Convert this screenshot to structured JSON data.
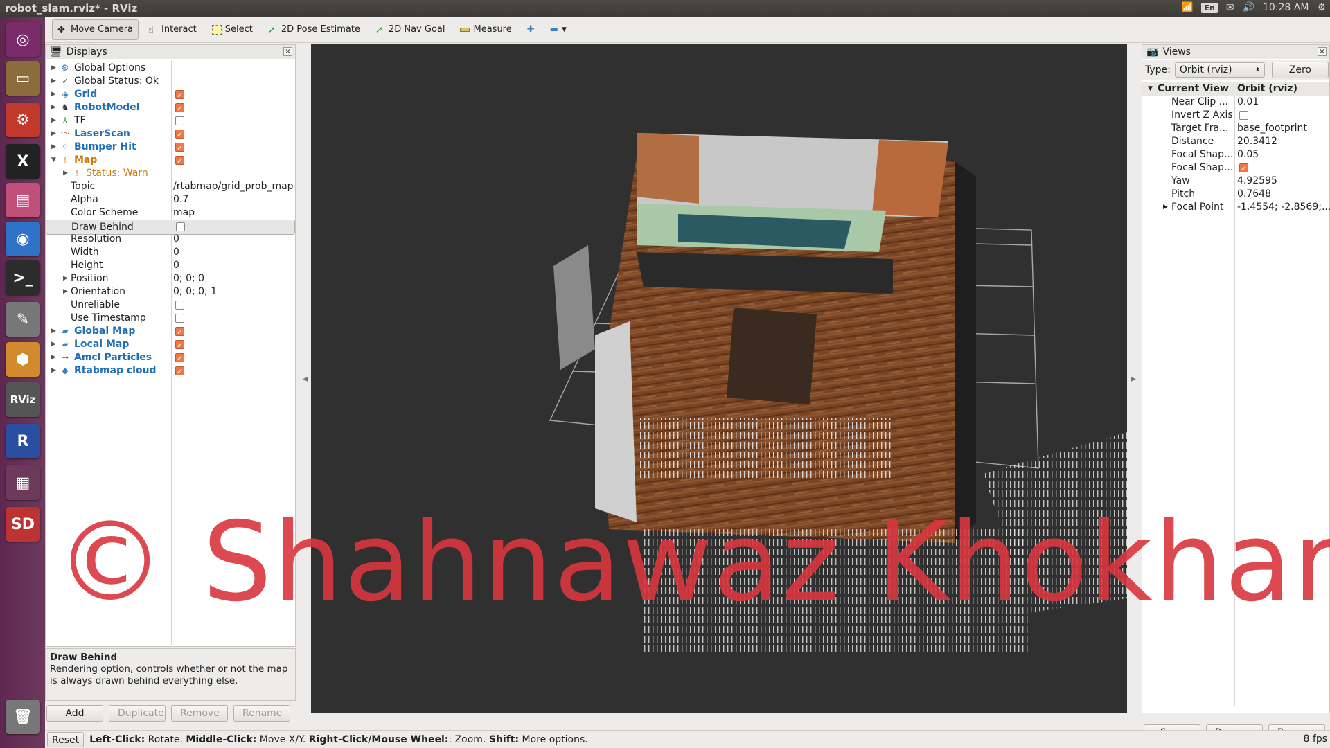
{
  "window_title": "robot_slam.rviz* - RViz",
  "tray": {
    "lang": "En",
    "time": "10:28 AM"
  },
  "launcher": [
    {
      "name": "ubuntu-dash-icon",
      "label": "◎",
      "color": "#7a2b6a"
    },
    {
      "name": "files-icon",
      "label": "▭",
      "color": "#8a6d3b"
    },
    {
      "name": "system-settings-icon",
      "label": "⚙",
      "color": "#c0392b"
    },
    {
      "name": "xterm-icon",
      "label": "X",
      "color": "#222"
    },
    {
      "name": "window-icon",
      "label": "▤",
      "color": "#c0507a"
    },
    {
      "name": "chromium-icon",
      "label": "◉",
      "color": "#2f73c9"
    },
    {
      "name": "terminal-icon",
      "label": ">_",
      "color": "#2c2c2c"
    },
    {
      "name": "text-editor-icon",
      "label": "✎",
      "color": "#777"
    },
    {
      "name": "package-icon",
      "label": "⬢",
      "color": "#d28a2e"
    },
    {
      "name": "rviz-icon",
      "label": "RViz",
      "color": "#555"
    },
    {
      "name": "rqt-icon",
      "label": "R",
      "color": "#2a4fa0"
    },
    {
      "name": "workspace-icon",
      "label": "▦",
      "color": "#6d3a5c"
    },
    {
      "name": "sd-card-icon",
      "label": "SD",
      "color": "#b33"
    },
    {
      "name": "trash-icon",
      "label": "🗑",
      "color": "#777"
    }
  ],
  "toolbar": {
    "tools": [
      "Move Camera",
      "Interact",
      "Select",
      "2D Pose Estimate",
      "2D Nav Goal",
      "Measure"
    ]
  },
  "displays": {
    "title": "Displays",
    "rows": [
      {
        "name": "Global Options",
        "style": "",
        "value": "",
        "cb": null,
        "indent": 0,
        "arrow": "▶",
        "icon": "⚙",
        "iconColor": "#3a7fc1"
      },
      {
        "name": "Global Status: Ok",
        "style": "",
        "value": "",
        "cb": null,
        "indent": 0,
        "arrow": "▶",
        "icon": "✓",
        "iconColor": "#1a7a1a"
      },
      {
        "name": "Grid",
        "style": "blue",
        "value": "",
        "cb": true,
        "indent": 0,
        "arrow": "▶",
        "icon": "◈",
        "iconColor": "#3a7fc1"
      },
      {
        "name": "RobotModel",
        "style": "blue",
        "value": "",
        "cb": true,
        "indent": 0,
        "arrow": "▶",
        "icon": "♞",
        "iconColor": "#333"
      },
      {
        "name": "TF",
        "style": "",
        "value": "",
        "cb": false,
        "indent": 0,
        "arrow": "▶",
        "icon": "⅄",
        "iconColor": "#2a8a2a"
      },
      {
        "name": "LaserScan",
        "style": "blue",
        "value": "",
        "cb": true,
        "indent": 0,
        "arrow": "▶",
        "icon": "〰",
        "iconColor": "#c33"
      },
      {
        "name": "Bumper Hit",
        "style": "blue",
        "value": "",
        "cb": true,
        "indent": 0,
        "arrow": "▶",
        "icon": "⁘",
        "iconColor": "#3a7fc1"
      },
      {
        "name": "Map",
        "style": "orange",
        "value": "",
        "cb": true,
        "indent": 0,
        "arrow": "▼",
        "icon": "!",
        "iconColor": "#e08a1a"
      },
      {
        "name": "Status: Warn",
        "style": "orangeplain",
        "value": "",
        "cb": null,
        "indent": 1,
        "arrow": "▶",
        "icon": "!",
        "iconColor": "#e08a1a"
      },
      {
        "name": "Topic",
        "style": "",
        "value": "/rtabmap/grid_prob_map",
        "cb": null,
        "indent": 1,
        "arrow": "",
        "icon": "",
        "iconColor": ""
      },
      {
        "name": "Alpha",
        "style": "",
        "value": "0.7",
        "cb": null,
        "indent": 1,
        "arrow": "",
        "icon": "",
        "iconColor": ""
      },
      {
        "name": "Color Scheme",
        "style": "",
        "value": "map",
        "cb": null,
        "indent": 1,
        "arrow": "",
        "icon": "",
        "iconColor": ""
      },
      {
        "name": "Draw Behind",
        "style": "",
        "value": "",
        "cb": false,
        "indent": 1,
        "arrow": "",
        "icon": "",
        "iconColor": "",
        "selected": true
      },
      {
        "name": "Resolution",
        "style": "",
        "value": "0",
        "cb": null,
        "indent": 1,
        "arrow": "",
        "icon": "",
        "iconColor": ""
      },
      {
        "name": "Width",
        "style": "",
        "value": "0",
        "cb": null,
        "indent": 1,
        "arrow": "",
        "icon": "",
        "iconColor": ""
      },
      {
        "name": "Height",
        "style": "",
        "value": "0",
        "cb": null,
        "indent": 1,
        "arrow": "",
        "icon": "",
        "iconColor": ""
      },
      {
        "name": "Position",
        "style": "",
        "value": "0; 0; 0",
        "cb": null,
        "indent": 1,
        "arrow": "▶",
        "icon": "",
        "iconColor": ""
      },
      {
        "name": "Orientation",
        "style": "",
        "value": "0; 0; 0; 1",
        "cb": null,
        "indent": 1,
        "arrow": "▶",
        "icon": "",
        "iconColor": ""
      },
      {
        "name": "Unreliable",
        "style": "",
        "value": "",
        "cb": false,
        "indent": 1,
        "arrow": "",
        "icon": "",
        "iconColor": ""
      },
      {
        "name": "Use Timestamp",
        "style": "",
        "value": "",
        "cb": false,
        "indent": 1,
        "arrow": "",
        "icon": "",
        "iconColor": ""
      },
      {
        "name": "Global Map",
        "style": "blue",
        "value": "",
        "cb": true,
        "indent": 0,
        "arrow": "▶",
        "icon": "▰",
        "iconColor": "#3a7fc1"
      },
      {
        "name": "Local Map",
        "style": "blue",
        "value": "",
        "cb": true,
        "indent": 0,
        "arrow": "▶",
        "icon": "▰",
        "iconColor": "#3a7fc1"
      },
      {
        "name": "Amcl Particles",
        "style": "blue",
        "value": "",
        "cb": true,
        "indent": 0,
        "arrow": "▶",
        "icon": "⇝",
        "iconColor": "#c33"
      },
      {
        "name": "Rtabmap cloud",
        "style": "blue",
        "value": "",
        "cb": true,
        "indent": 0,
        "arrow": "▶",
        "icon": "◆",
        "iconColor": "#3a7fc1"
      }
    ],
    "help_title": "Draw Behind",
    "help_text": "Rendering option, controls whether or not the map is always drawn behind everything else.",
    "buttons": [
      "Add",
      "Duplicate",
      "Remove",
      "Rename"
    ]
  },
  "views": {
    "title": "Views",
    "type_label": "Type:",
    "type_value": "Orbit (rviz)",
    "zero_label": "Zero",
    "rows": [
      {
        "name": "Current View",
        "value": "Orbit (rviz)",
        "header": true,
        "arrow": "▼"
      },
      {
        "name": "Near Clip ...",
        "value": "0.01"
      },
      {
        "name": "Invert Z Axis",
        "value": "",
        "cb": false
      },
      {
        "name": "Target Fra...",
        "value": "base_footprint"
      },
      {
        "name": "Distance",
        "value": "20.3412"
      },
      {
        "name": "Focal Shap...",
        "value": "0.05"
      },
      {
        "name": "Focal Shap...",
        "value": "",
        "cb": true
      },
      {
        "name": "Yaw",
        "value": "4.92595"
      },
      {
        "name": "Pitch",
        "value": "0.7648"
      },
      {
        "name": "Focal Point",
        "value": "-1.4554; -2.8569;...",
        "arrow": "▶"
      }
    ],
    "buttons": [
      "Save",
      "Remove",
      "Rename"
    ]
  },
  "status": {
    "reset": "Reset",
    "fps": "8 fps",
    "parts": [
      [
        "Left-Click:",
        " Rotate. "
      ],
      [
        "Middle-Click:",
        " Move X/Y. "
      ],
      [
        "Right-Click/Mouse Wheel:",
        ": Zoom. "
      ],
      [
        "Shift:",
        " More options."
      ]
    ]
  },
  "watermark": "© Shahnawaz Khokhar"
}
